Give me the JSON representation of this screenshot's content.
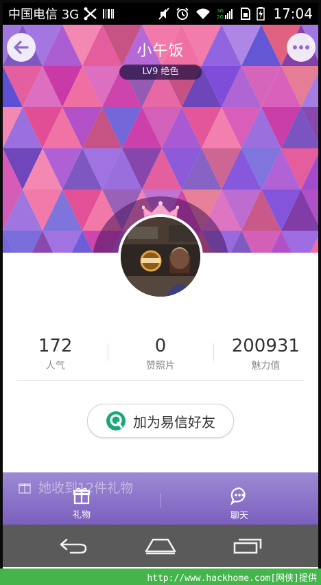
{
  "status_bar": {
    "carrier": "中国电信 3G",
    "time": "17:04"
  },
  "header": {
    "username": "小午饭",
    "level": "LV9 绝色",
    "back_icon": "back-arrow-icon",
    "more_icon": "more-dots-icon"
  },
  "stats": [
    {
      "value": "172",
      "label": "人气"
    },
    {
      "value": "0",
      "label": "赞照片"
    },
    {
      "value": "200931",
      "label": "魅力值"
    }
  ],
  "add_friend": {
    "label": "加为易信好友",
    "icon": "yixin-logo-icon"
  },
  "gifts": {
    "text": "她收到12件礼物"
  },
  "actions": [
    {
      "label": "礼物",
      "icon": "gift-icon"
    },
    {
      "label": "聊天",
      "icon": "chat-icon"
    }
  ],
  "watermark": "http://www.hackhome.com[网侠]提供",
  "colors": {
    "accent_purple": "#7b5fbf",
    "yixin_green": "#1aa87a"
  }
}
